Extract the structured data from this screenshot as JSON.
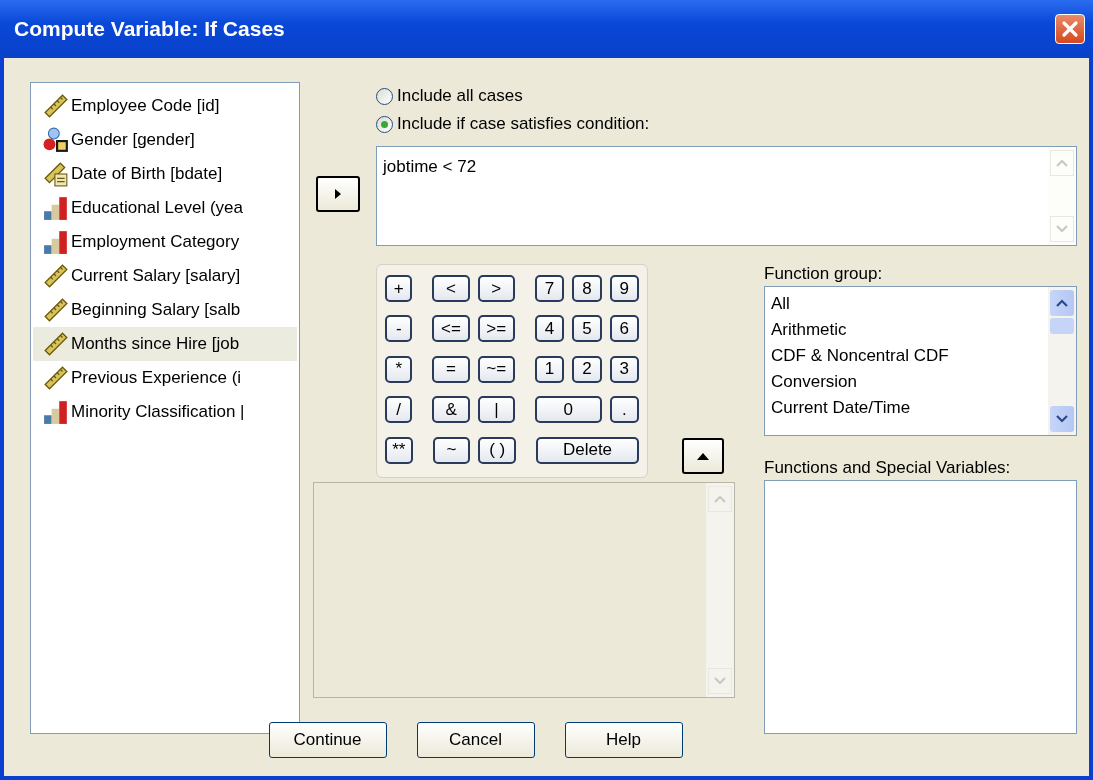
{
  "window": {
    "title": "Compute Variable: If Cases"
  },
  "variables": [
    {
      "name": "Employee Code [id]",
      "kind": "scale",
      "selected": false
    },
    {
      "name": "Gender [gender]",
      "kind": "nominal",
      "selected": false
    },
    {
      "name": "Date of Birth [bdate]",
      "kind": "date",
      "selected": false
    },
    {
      "name": "Educational Level (yea",
      "kind": "ordinal",
      "selected": false
    },
    {
      "name": "Employment Category",
      "kind": "ordinal",
      "selected": false
    },
    {
      "name": "Current Salary [salary]",
      "kind": "scale",
      "selected": false
    },
    {
      "name": "Beginning Salary [salb",
      "kind": "scale",
      "selected": false
    },
    {
      "name": "Months since Hire [job",
      "kind": "scale",
      "selected": true
    },
    {
      "name": "Previous Experience (i",
      "kind": "scale",
      "selected": false
    },
    {
      "name": "Minority Classification |",
      "kind": "ordinal",
      "selected": false
    }
  ],
  "case_options": [
    {
      "label": "Include all cases",
      "selected": false
    },
    {
      "label": "Include if case satisfies condition:",
      "selected": true
    }
  ],
  "condition": {
    "value": "jobtime < 72"
  },
  "keypad": [
    [
      "+",
      "<",
      ">",
      "7",
      "8",
      "9"
    ],
    [
      "-",
      "<=",
      ">=",
      "4",
      "5",
      "6"
    ],
    [
      "*",
      "=",
      "~=",
      "1",
      "2",
      "3"
    ],
    [
      "/",
      "&",
      "|",
      "0",
      "."
    ],
    [
      "**",
      "~",
      "( )",
      "Delete"
    ]
  ],
  "function_group": {
    "label": "Function group:",
    "items": [
      "All",
      "Arithmetic",
      "CDF & Noncentral CDF",
      "Conversion",
      "Current Date/Time"
    ]
  },
  "functions": {
    "label": "Functions and Special Variables:"
  },
  "buttons": [
    "Continue",
    "Cancel",
    "Help"
  ]
}
